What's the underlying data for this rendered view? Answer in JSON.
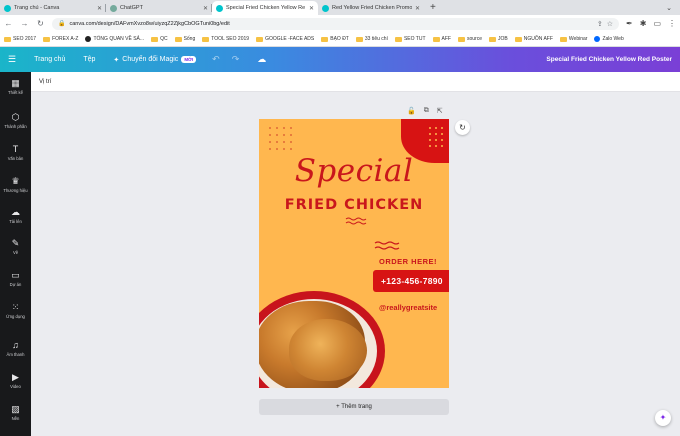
{
  "browser": {
    "tabs": [
      {
        "title": "Trang chủ - Canva",
        "favicon_color": "#00c4cc",
        "active": false
      },
      {
        "title": "ChatGPT",
        "favicon_color": "#74aa9c",
        "active": false
      },
      {
        "title": "Special Fried Chicken Yellow Re",
        "favicon_color": "#00c4cc",
        "active": true
      },
      {
        "title": "Red Yellow Fried Chicken Promo",
        "favicon_color": "#00c4cc",
        "active": false
      }
    ],
    "new_tab_label": "+",
    "url": "canva.com/design/DAFvmXvzo8w/uiyzqZ2ZjkgCbOGTuni0bg/edit"
  },
  "bookmarks": [
    {
      "label": "SEO 2017",
      "kind": "folder"
    },
    {
      "label": "FOREX A-Z",
      "kind": "folder"
    },
    {
      "label": "TỔNG QUAN VỀ SẢ...",
      "kind": "globe"
    },
    {
      "label": "QC",
      "kind": "folder"
    },
    {
      "label": "Sống",
      "kind": "folder"
    },
    {
      "label": "TOOL SEO 2019",
      "kind": "folder"
    },
    {
      "label": "GOOGLE -FACE ADS",
      "kind": "folder"
    },
    {
      "label": "BẠO ĐT",
      "kind": "folder"
    },
    {
      "label": "33 tiêu chí",
      "kind": "folder"
    },
    {
      "label": "SEO TUT",
      "kind": "folder"
    },
    {
      "label": "AFF",
      "kind": "folder"
    },
    {
      "label": "source",
      "kind": "folder"
    },
    {
      "label": "JOB",
      "kind": "folder"
    },
    {
      "label": "NGUỒN AFF",
      "kind": "folder"
    },
    {
      "label": "Webinar",
      "kind": "folder"
    },
    {
      "label": "Zalo Web",
      "kind": "globe"
    }
  ],
  "canva_toolbar": {
    "home_label": "Trang chủ",
    "file_label": "Tệp",
    "magic_label": "Chuyển đổi Magic",
    "magic_badge": "MỚI",
    "design_title": "Special Fried Chicken Yellow Red Poster"
  },
  "sidebar": [
    {
      "label": "Thiết kế",
      "icon": "layout-icon"
    },
    {
      "label": "Thành phần",
      "icon": "shapes-icon"
    },
    {
      "label": "Văn bản",
      "icon": "text-icon"
    },
    {
      "label": "Thương hiệu",
      "icon": "brand-icon"
    },
    {
      "label": "Tải lên",
      "icon": "upload-icon"
    },
    {
      "label": "Vẽ",
      "icon": "draw-icon"
    },
    {
      "label": "Dự án",
      "icon": "folder-icon"
    },
    {
      "label": "Ứng dụng",
      "icon": "apps-icon"
    },
    {
      "label": "Âm thanh",
      "icon": "audio-icon"
    },
    {
      "label": "Video",
      "icon": "video-icon"
    },
    {
      "label": "Nền",
      "icon": "background-icon"
    }
  ],
  "subbar": {
    "position_label": "Vị trí"
  },
  "poster": {
    "headline_script": "Special",
    "headline": "FRIED CHICKEN",
    "order_label": "ORDER HERE!",
    "phone": "+123-456-7890",
    "handle": "@reallygreatsite",
    "colors": {
      "background": "#ffb74f",
      "accent": "#c9171c"
    }
  },
  "add_page_label": "+ Thêm trang"
}
